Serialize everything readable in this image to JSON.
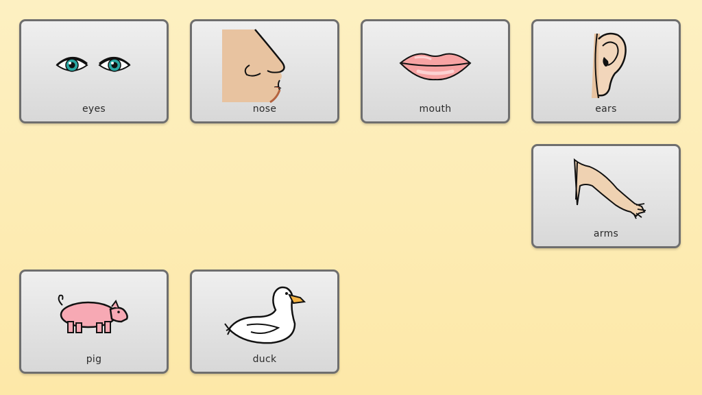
{
  "tiles": {
    "eyes": {
      "label": "eyes",
      "icon": "eyes-icon"
    },
    "nose": {
      "label": "nose",
      "icon": "nose-icon"
    },
    "mouth": {
      "label": "mouth",
      "icon": "mouth-icon"
    },
    "ears": {
      "label": "ears",
      "icon": "ear-icon"
    },
    "arms": {
      "label": "arms",
      "icon": "arm-icon"
    },
    "pig": {
      "label": "pig",
      "icon": "pig-icon"
    },
    "duck": {
      "label": "duck",
      "icon": "duck-icon"
    }
  },
  "colors": {
    "background": "#fde8a8",
    "tile_border": "#6e6e6e",
    "tile_fill": "#e2e2e2"
  }
}
